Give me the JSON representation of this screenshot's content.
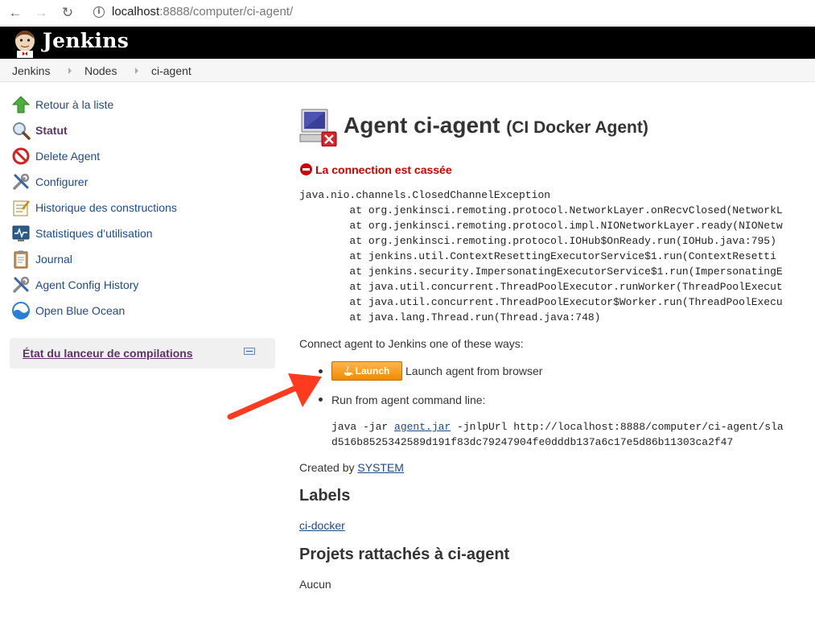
{
  "browser": {
    "url_host": "localhost",
    "url_rest": ":8888/computer/ci-agent/"
  },
  "header": {
    "logo_text": "Jenkins"
  },
  "breadcrumb": [
    "Jenkins",
    "Nodes",
    "ci-agent"
  ],
  "sidebar": {
    "tasks": [
      {
        "label": "Retour à la liste",
        "icon": "up-arrow-icon"
      },
      {
        "label": "Statut",
        "icon": "magnifier-icon",
        "active": true
      },
      {
        "label": "Delete Agent",
        "icon": "no-entry-icon"
      },
      {
        "label": "Configurer",
        "icon": "tools-icon"
      },
      {
        "label": "Historique des constructions",
        "icon": "notepad-icon"
      },
      {
        "label": "Statistiques d’utilisation",
        "icon": "monitor-graph-icon"
      },
      {
        "label": "Journal",
        "icon": "clipboard-icon"
      },
      {
        "label": "Agent Config History",
        "icon": "tools-icon"
      },
      {
        "label": "Open Blue Ocean",
        "icon": "blue-ocean-icon"
      }
    ],
    "executors_title": "État du lanceur de compilations"
  },
  "main": {
    "title": "Agent ci-agent",
    "subtitle": "(CI Docker Agent)",
    "connection_status": "La connection est cassée",
    "stack_trace": "java.nio.channels.ClosedChannelException\n\tat org.jenkinsci.remoting.protocol.NetworkLayer.onRecvClosed(NetworkL\n\tat org.jenkinsci.remoting.protocol.impl.NIONetworkLayer.ready(NIONetw\n\tat org.jenkinsci.remoting.protocol.IOHub$OnReady.run(IOHub.java:795)\n\tat jenkins.util.ContextResettingExecutorService$1.run(ContextResetti\n\tat jenkins.security.ImpersonatingExecutorService$1.run(ImpersonatingE\n\tat java.util.concurrent.ThreadPoolExecutor.runWorker(ThreadPoolExecut\n\tat java.util.concurrent.ThreadPoolExecutor$Worker.run(ThreadPoolExecu\n\tat java.lang.Thread.run(Thread.java:748)",
    "connect_intro": "Connect agent to Jenkins one of these ways:",
    "launch_button": "Launch",
    "launch_desc": "Launch agent from browser",
    "run_label": "Run from agent command line:",
    "cmd_prefix": "java -jar ",
    "cmd_jar": "agent.jar",
    "cmd_rest": " -jnlpUrl http://localhost:8888/computer/ci-agent/sla",
    "cmd_secret": "d516b8525342589d191f83dc79247904fe0dddb137a6c17e5d86b11303ca2f47",
    "created_by_label": "Created by ",
    "created_by_user": "SYSTEM",
    "labels_heading": "Labels",
    "label_value": "ci-docker",
    "projects_heading": "Projets rattachés à ci-agent",
    "projects_none": "Aucun"
  },
  "colors": {
    "link": "#204a87",
    "error": "#cc0000",
    "launch_orange": "#f08b00",
    "annotation_arrow": "#ff3b1f"
  }
}
